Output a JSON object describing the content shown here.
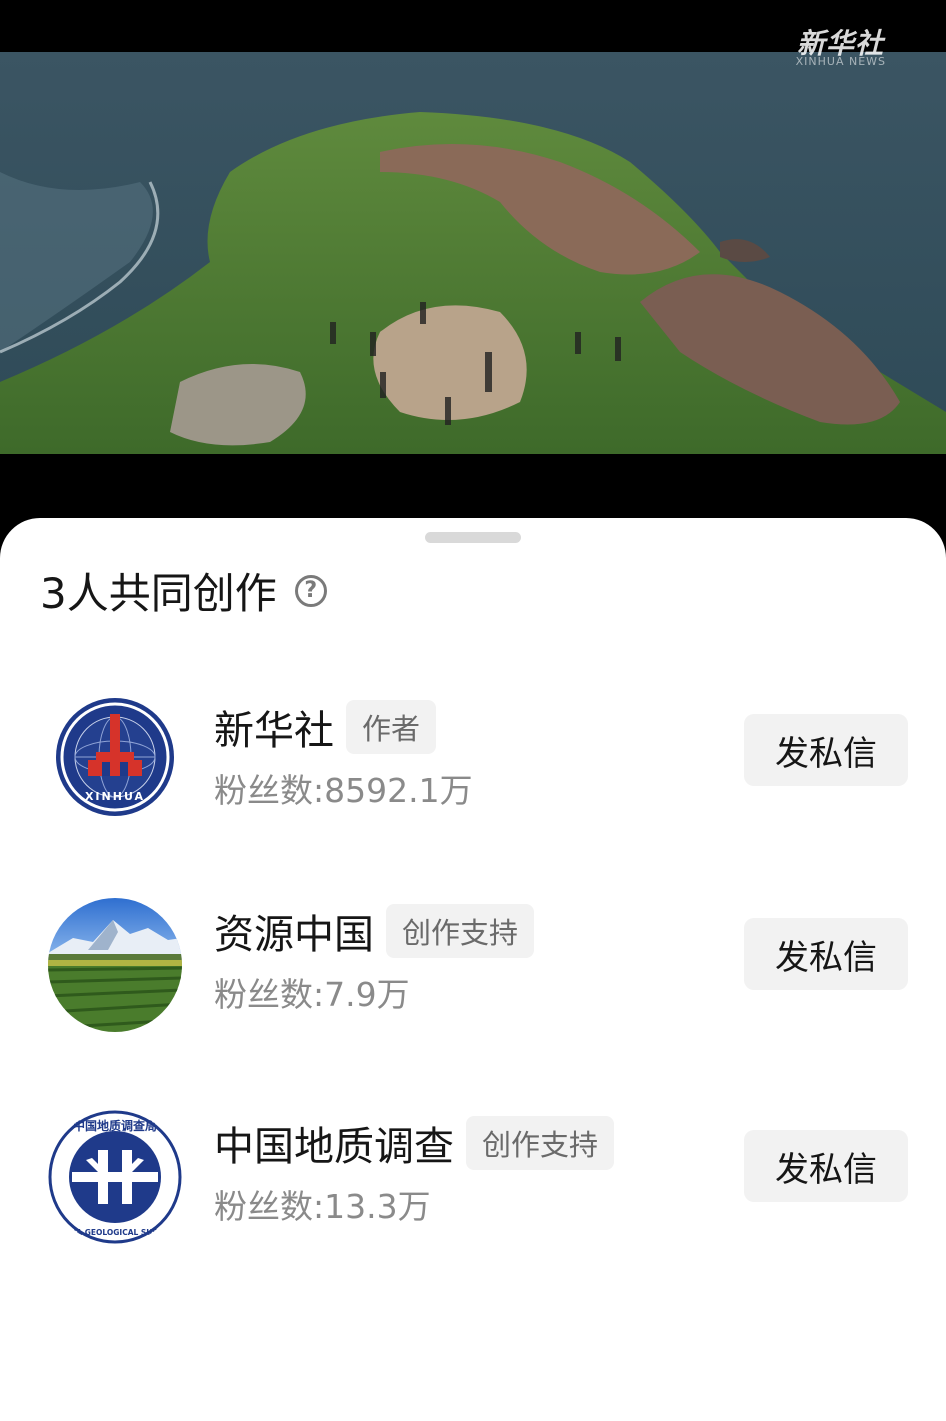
{
  "video": {
    "watermark": "新华社",
    "watermark_sub": "XINHUA NEWS",
    "subtitle": "",
    "background_color": "#000000"
  },
  "sheet": {
    "title": "3人共同创作",
    "help_icon": "help-circle-icon",
    "creators": [
      {
        "name": "新华社",
        "role": "作者",
        "fans": "粉丝数:8592.1万",
        "button": "发私信",
        "avatar": "xinhua-logo"
      },
      {
        "name": "资源中国",
        "role": "创作支持",
        "fans": "粉丝数:7.9万",
        "button": "发私信",
        "avatar": "mountain-field-photo"
      },
      {
        "name": "中国地质调查",
        "role": "创作支持",
        "fans": "粉丝数:13.3万",
        "button": "发私信",
        "avatar": "china-geological-survey-logo",
        "avatar_text_top": "中国地质调查局",
        "avatar_text_bottom": "CHINA GEOLOGICAL SURVEY"
      }
    ]
  },
  "colors": {
    "sheet_bg": "#ffffff",
    "tag_bg": "#f2f2f2",
    "secondary_text": "#8a8a8a",
    "logo_blue": "#1f3a8a",
    "logo_red": "#d6332a"
  }
}
